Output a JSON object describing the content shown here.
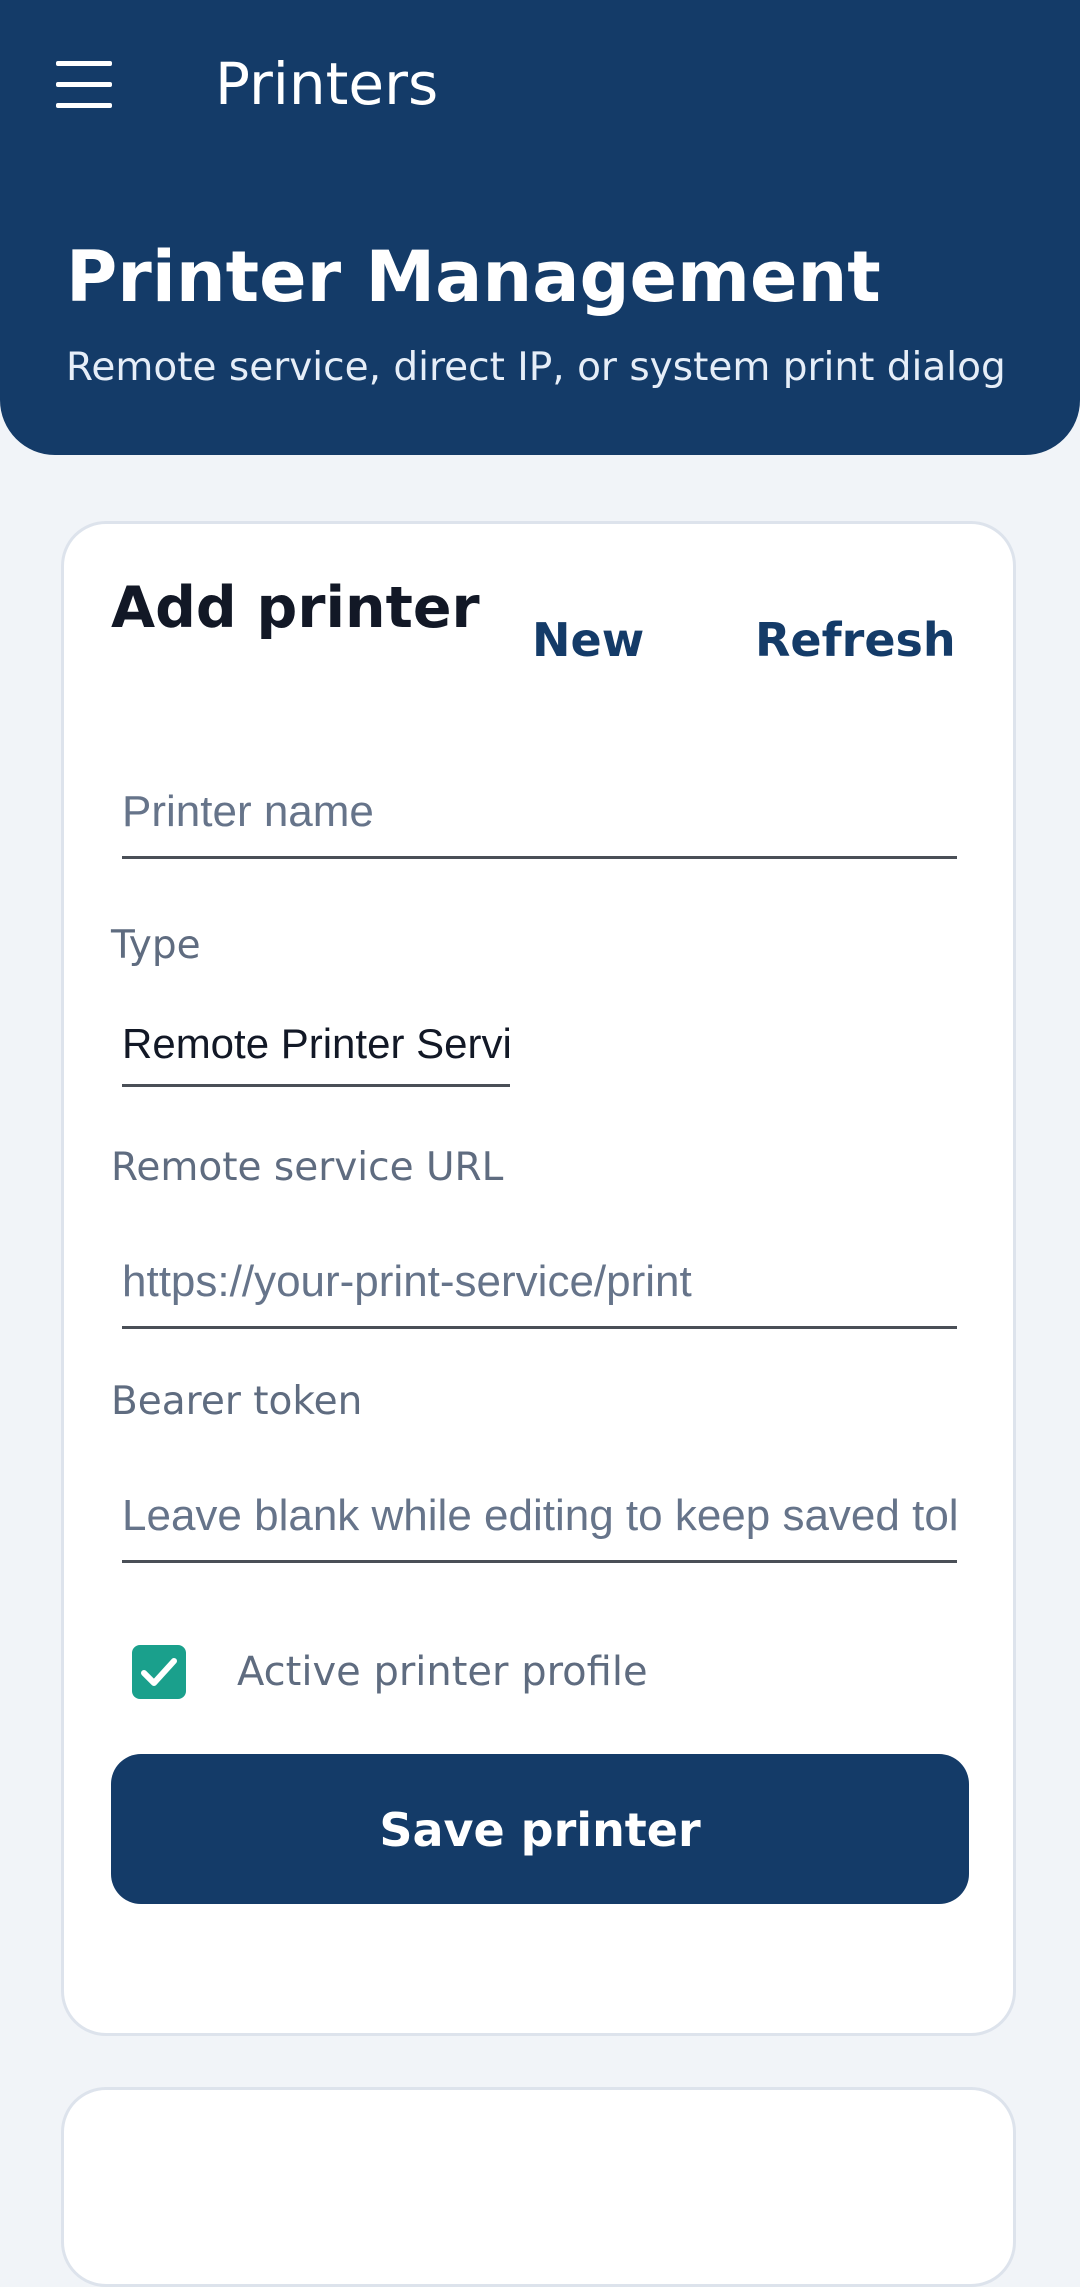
{
  "app_bar": {
    "title": "Printers",
    "menu_icon": "hamburger-menu-icon"
  },
  "hero": {
    "title": "Printer Management",
    "subtitle": "Remote service, direct IP, or system print dialog"
  },
  "add_printer_card": {
    "title": "Add printer",
    "new_label": "New",
    "refresh_label": "Refresh",
    "printer_name_placeholder": "Printer name",
    "type_label": "Type",
    "type_value": "Remote Printer Servi",
    "remote_url_label": "Remote service URL",
    "remote_url_placeholder": "https://your-print-service/print",
    "bearer_token_label": "Bearer token",
    "bearer_token_placeholder": "Leave blank while editing to keep saved tol",
    "active_label": "Active printer profile",
    "active_checked": true,
    "save_label": "Save printer"
  },
  "colors": {
    "primary": "#143b68",
    "background": "#f1f4f8",
    "checkbox": "#1aa08c"
  }
}
